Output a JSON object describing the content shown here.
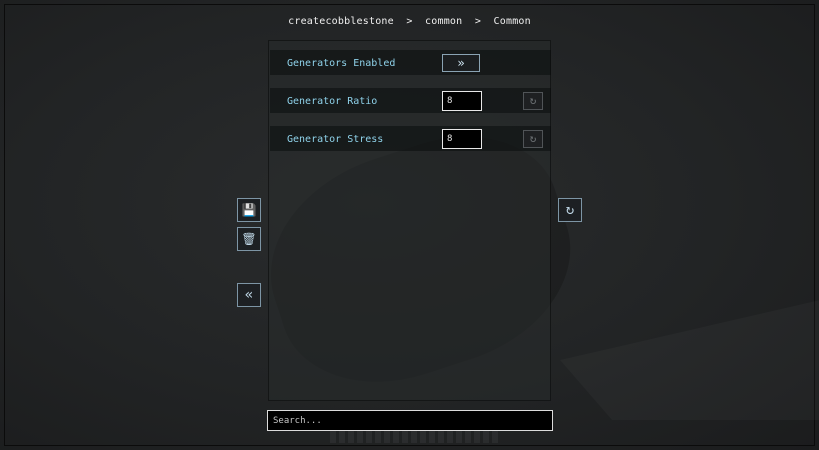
{
  "breadcrumb": {
    "mod": "createcobblestone",
    "separator": ">",
    "section": "common",
    "page": "Common"
  },
  "settings": [
    {
      "label": "Generators Enabled",
      "control": "toggle",
      "icon": "double-chevron-right-icon",
      "glyph": "»"
    },
    {
      "label": "Generator Ratio",
      "control": "number",
      "value": "8",
      "reset_glyph": "↻"
    },
    {
      "label": "Generator Stress",
      "control": "number",
      "value": "8",
      "reset_glyph": "↻"
    }
  ],
  "side_buttons": {
    "save_glyph": "💾",
    "delete_glyph": "🗑",
    "back_glyph": "«",
    "reset_all_glyph": "↻"
  },
  "search": {
    "placeholder": "Search..."
  },
  "colors": {
    "label": "#8fd2ea",
    "accent_border": "#8aa3b3",
    "background": "#242627"
  }
}
